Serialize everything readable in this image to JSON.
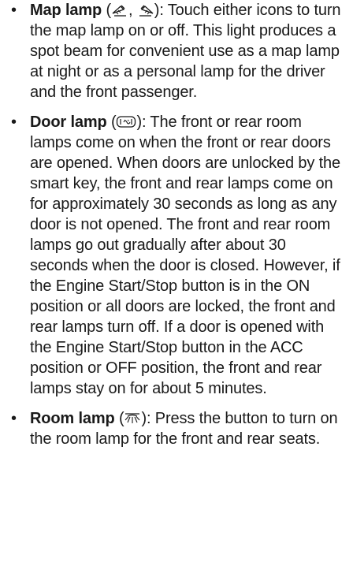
{
  "items": [
    {
      "term": "Map lamp",
      "open_paren": " (",
      "separator": ", ",
      "close_paren": ")",
      "icons": [
        "map-lamp-left-icon",
        "map-lamp-right-icon"
      ],
      "text": ": Touch either icons to turn the map lamp on or off. This light produces a spot beam for convenient use as a map lamp at night or as a personal lamp for the driver and the front passenger."
    },
    {
      "term": "Door lamp",
      "open_paren": " (",
      "close_paren": ")",
      "icons": [
        "door-lamp-icon"
      ],
      "text": ": The front or rear room lamps come on when the front or rear doors are opened. When doors are unlocked by the smart key, the front and rear lamps come on for approximately 30 seconds as long as any door is not opened. The front and rear room lamps go out gradually after about 30 seconds when the door is closed. However, if the Engine Start/Stop button is in the ON position or all doors are locked, the front and rear lamps turn off. If a door is opened with the Engine Start/Stop button in the ACC position or OFF position, the front and rear lamps stay on for about 5 minutes."
    },
    {
      "term": "Room lamp",
      "open_paren": " (",
      "close_paren": ")",
      "icons": [
        "room-lamp-icon"
      ],
      "text": ": Press the button to turn on the room lamp for the front and rear seats."
    }
  ],
  "bullet_char": "•"
}
